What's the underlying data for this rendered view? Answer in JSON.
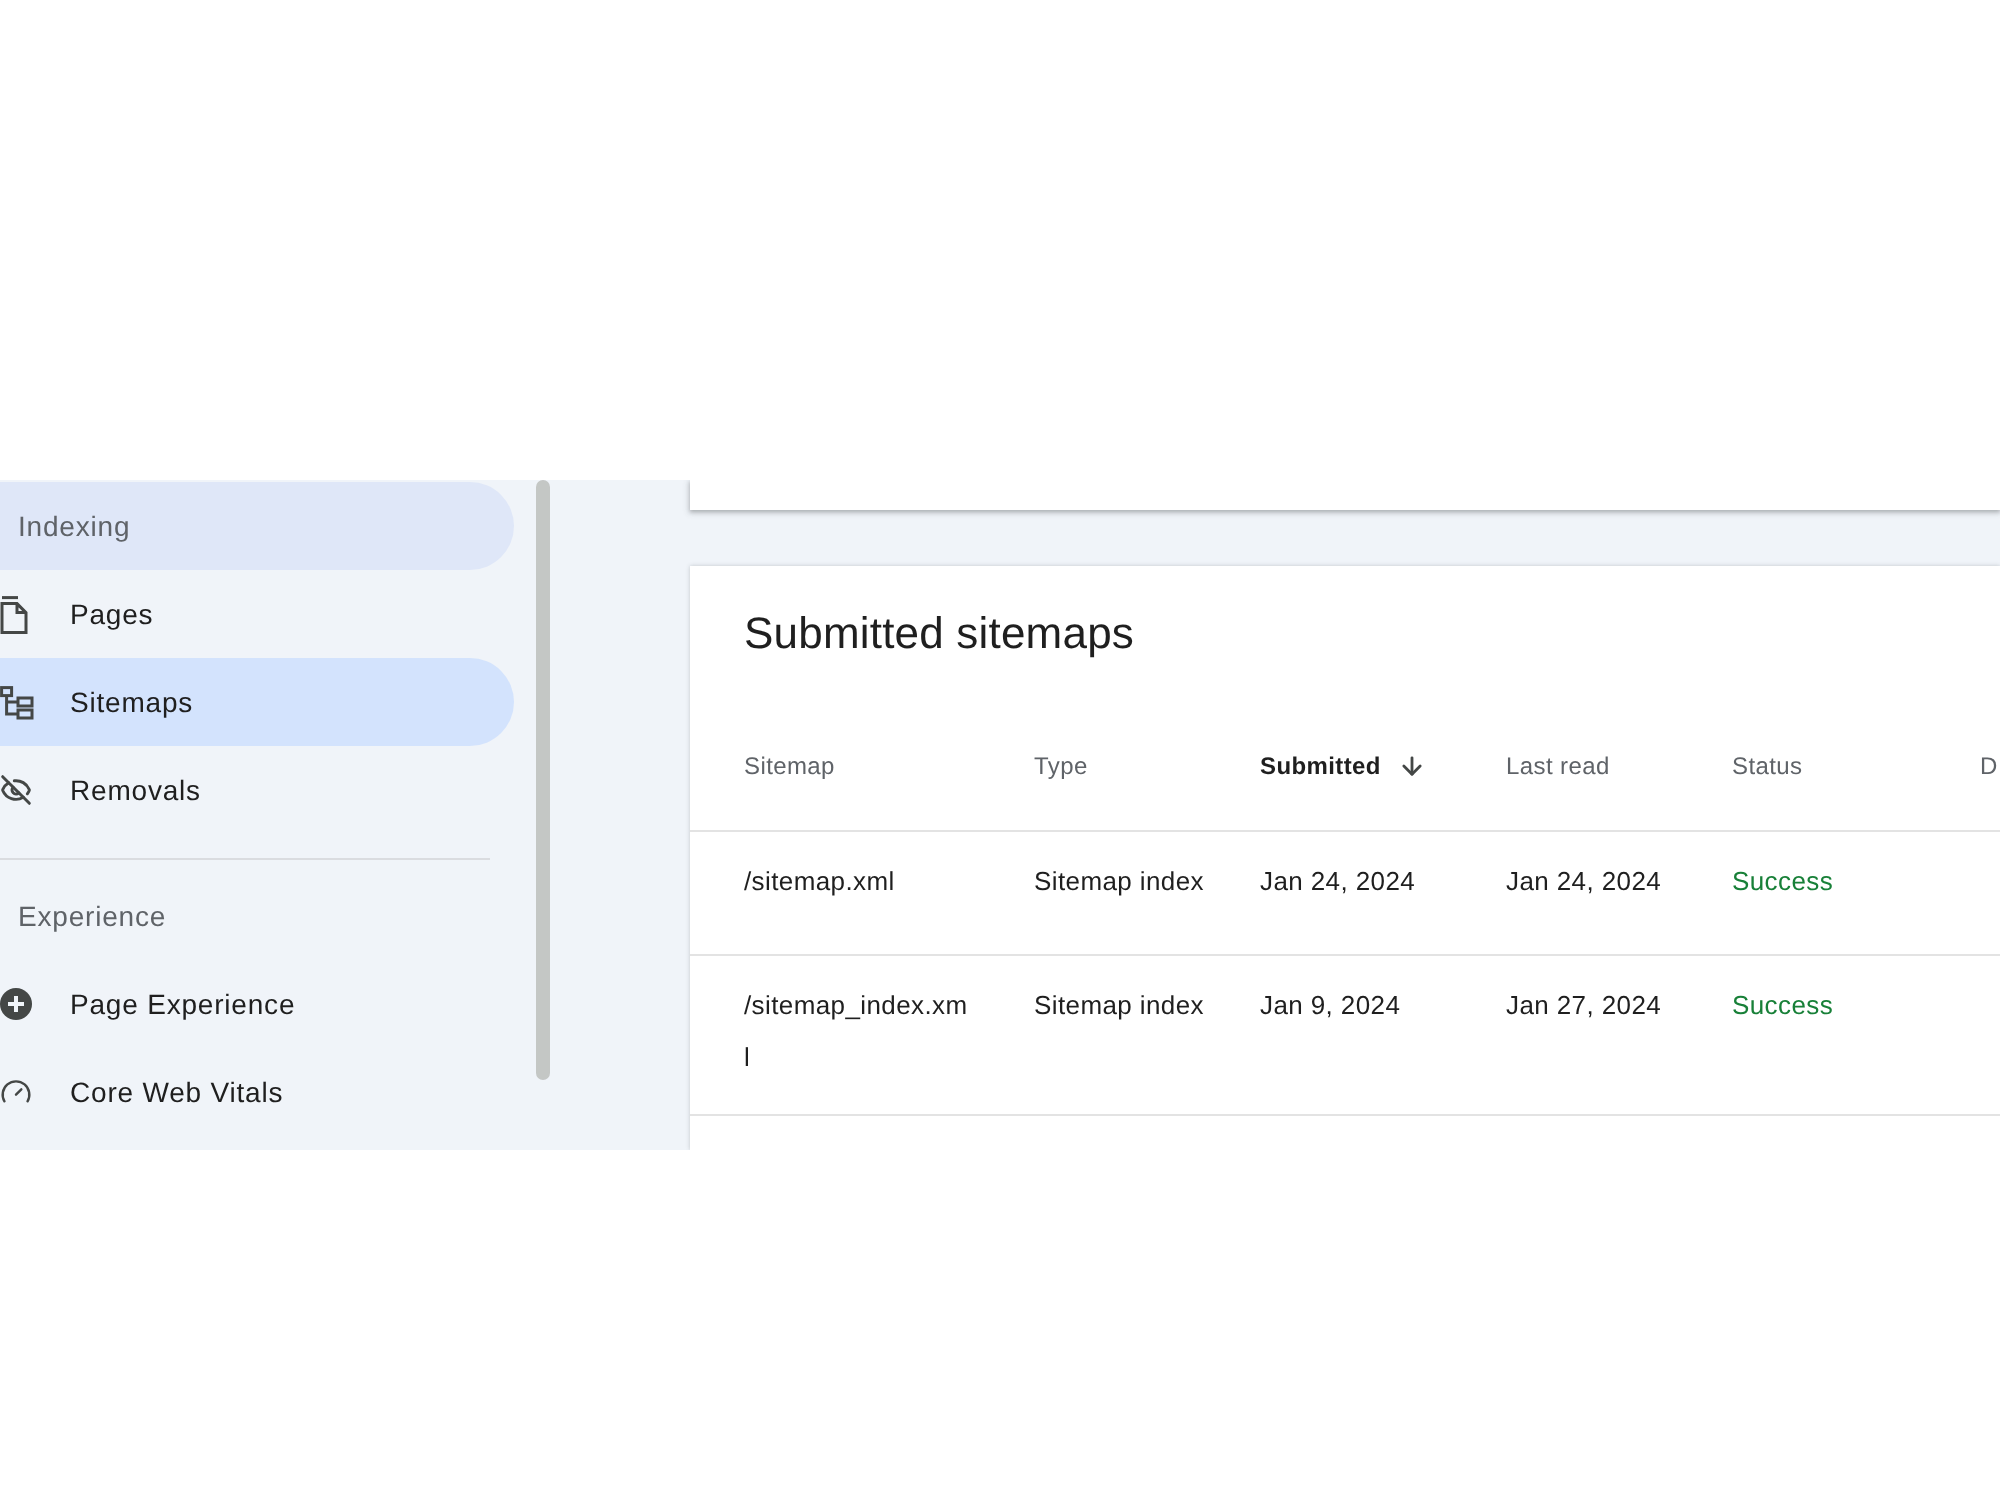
{
  "sidebar": {
    "sections": [
      {
        "title": "Indexing",
        "highlighted": true,
        "items": [
          {
            "label": "Pages",
            "selected": false
          },
          {
            "label": "Sitemaps",
            "selected": true
          },
          {
            "label": "Removals",
            "selected": false
          }
        ]
      },
      {
        "title": "Experience",
        "highlighted": false,
        "items": [
          {
            "label": "Page Experience",
            "selected": false
          },
          {
            "label": "Core Web Vitals",
            "selected": false
          }
        ]
      }
    ]
  },
  "sitemaps_card": {
    "title": "Submitted sitemaps",
    "columns": [
      {
        "label": "Sitemap",
        "sorted": false
      },
      {
        "label": "Type",
        "sorted": false
      },
      {
        "label": "Submitted",
        "sorted": true
      },
      {
        "label": "Last read",
        "sorted": false
      },
      {
        "label": "Status",
        "sorted": false
      },
      {
        "label": "D",
        "sorted": false
      }
    ],
    "rows": [
      {
        "sitemap": "/sitemap.xml",
        "type": "Sitemap index",
        "submitted": "Jan 24, 2024",
        "last_read": "Jan 24, 2024",
        "status": {
          "text": "Success",
          "kind": "success"
        }
      },
      {
        "sitemap": "/sitemap_index.xml",
        "type": "Sitemap index",
        "submitted": "Jan 9, 2024",
        "last_read": "Jan 27, 2024",
        "status": {
          "text": "Success",
          "kind": "success"
        }
      }
    ]
  }
}
